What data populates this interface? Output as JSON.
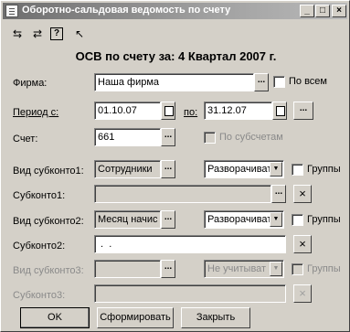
{
  "window": {
    "title": "Оборотно-сальдовая ведомость по счету",
    "controls": {
      "minimize": "_",
      "maximize": "□",
      "close": "×"
    }
  },
  "toolbar": {
    "icons": [
      "open-report-icon",
      "save-report-icon",
      "help-icon",
      "context-help-icon"
    ]
  },
  "heading": "ОСВ по счету за: 4 Квартал 2007 г.",
  "form": {
    "firm": {
      "label": "Фирма:",
      "value": "Наша фирма",
      "btn": "...",
      "all_label": "По всем"
    },
    "period": {
      "label": "Период с:",
      "from": "01.10.07",
      "to_label": "по:",
      "to": "31.12.07",
      "btn": "..."
    },
    "account": {
      "label": "Счет:",
      "value": "661",
      "btn": "...",
      "subaccounts_label": "По субсчетам"
    },
    "subconto1": {
      "kind_label": "Вид субконто1:",
      "kind_value": "Сотрудники",
      "kind_btn": "...",
      "mode": "Разворачиват",
      "groups_label": "Группы",
      "value_label": "Субконто1:",
      "value": "",
      "value_btn": "...",
      "clear": "×"
    },
    "subconto2": {
      "kind_label": "Вид субконто2:",
      "kind_value": "Месяц начис",
      "kind_btn": "...",
      "mode": "Разворачиват",
      "groups_label": "Группы",
      "value_label": "Субконто2:",
      "value": " .  . ",
      "clear": "×"
    },
    "subconto3": {
      "kind_label": "Вид субконто3:",
      "kind_value": "",
      "kind_btn": "...",
      "mode": "Не учитыват",
      "groups_label": "Группы",
      "value_label": "Субконто3:",
      "value": "",
      "clear": "×"
    }
  },
  "buttons": {
    "ok": "OK",
    "build": "Сформировать",
    "close": "Закрыть"
  }
}
